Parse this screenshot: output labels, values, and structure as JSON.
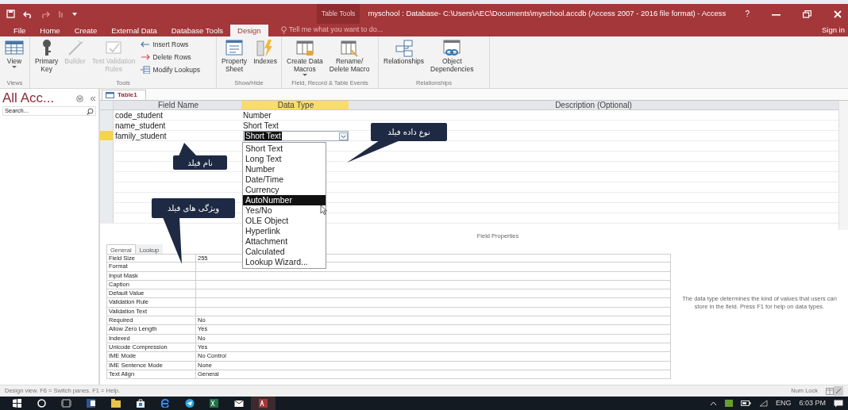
{
  "window": {
    "context_label": "Table Tools",
    "title": "myschool : Database- C:\\Users\\AEC\\Documents\\myschool.accdb (Access 2007 - 2016 file format) - Access",
    "help": "?"
  },
  "ribbon_tabs": [
    {
      "label": "File",
      "selected": false
    },
    {
      "label": "Home",
      "selected": false
    },
    {
      "label": "Create",
      "selected": false
    },
    {
      "label": "External Data",
      "selected": false
    },
    {
      "label": "Database Tools",
      "selected": false
    },
    {
      "label": "Design",
      "selected": true
    }
  ],
  "tell_me": {
    "placeholder": "Tell me what you want to do..."
  },
  "sign_in": "Sign in",
  "ribbon_groups": [
    {
      "label": "Views",
      "buttons": [
        {
          "label": "View",
          "kind": "large",
          "disabled": false,
          "dropdown": true
        }
      ]
    },
    {
      "label": "Tools",
      "buttons": [
        {
          "label": "Primary\nKey",
          "kind": "large",
          "disabled": false
        },
        {
          "label": "Builder",
          "kind": "large",
          "disabled": true
        },
        {
          "label": "Test Validation\nRules",
          "kind": "large",
          "disabled": true
        },
        {
          "label": "Insert Rows",
          "kind": "small",
          "disabled": false
        },
        {
          "label": "Delete Rows",
          "kind": "small",
          "disabled": false
        },
        {
          "label": "Modify Lookups",
          "kind": "small",
          "disabled": false
        }
      ]
    },
    {
      "label": "Show/Hide",
      "buttons": [
        {
          "label": "Property\nSheet",
          "kind": "large",
          "disabled": false
        },
        {
          "label": "Indexes",
          "kind": "large",
          "disabled": false
        }
      ]
    },
    {
      "label": "Field, Record & Table Events",
      "buttons": [
        {
          "label": "Create Data\nMacros",
          "kind": "large",
          "disabled": false,
          "dropdown": true
        },
        {
          "label": "Rename/\nDelete Macro",
          "kind": "large",
          "disabled": false
        }
      ]
    },
    {
      "label": "Relationships",
      "buttons": [
        {
          "label": "Relationships",
          "kind": "large",
          "disabled": false
        },
        {
          "label": "Object\nDependencies",
          "kind": "large",
          "disabled": false
        }
      ]
    }
  ],
  "nav_pane": {
    "title": "All Acc...",
    "search": {
      "placeholder": "Search..."
    }
  },
  "document_tabs": [
    {
      "label": "Table1",
      "selected": true
    }
  ],
  "design_grid": {
    "columns": [
      "Field Name",
      "Data Type",
      "Description (Optional)"
    ],
    "rows": [
      {
        "field_name": "code_student",
        "data_type": "Number",
        "selected": false
      },
      {
        "field_name": "name_student",
        "data_type": "Short Text",
        "selected": false
      },
      {
        "field_name": "family_student",
        "data_type": "Short Text",
        "selected": true
      }
    ]
  },
  "data_type_dropdown": {
    "options": [
      {
        "label": "Short Text",
        "selected": false
      },
      {
        "label": "Long Text",
        "selected": false
      },
      {
        "label": "Number",
        "selected": false
      },
      {
        "label": "Date/Time",
        "selected": false
      },
      {
        "label": "Currency",
        "selected": false
      },
      {
        "label": "AutoNumber",
        "selected": true
      },
      {
        "label": "Yes/No",
        "selected": false
      },
      {
        "label": "OLE Object",
        "selected": false
      },
      {
        "label": "Hyperlink",
        "selected": false
      },
      {
        "label": "Attachment",
        "selected": false
      },
      {
        "label": "Calculated",
        "selected": false
      },
      {
        "label": "Lookup Wizard...",
        "selected": false
      }
    ]
  },
  "field_properties": {
    "title": "Field Properties",
    "tabs": [
      {
        "label": "General",
        "selected": true
      },
      {
        "label": "Lookup",
        "selected": false
      }
    ],
    "rows": [
      {
        "name": "Field Size",
        "value": "255"
      },
      {
        "name": "Format"
      },
      {
        "name": "Input Mask"
      },
      {
        "name": "Caption"
      },
      {
        "name": "Default Value"
      },
      {
        "name": "Validation Rule"
      },
      {
        "name": "Validation Text"
      },
      {
        "name": "Required",
        "value": "No"
      },
      {
        "name": "Allow Zero Length",
        "value": "Yes"
      },
      {
        "name": "Indexed",
        "value": "No"
      },
      {
        "name": "Unicode Compression",
        "value": "Yes"
      },
      {
        "name": "IME Mode",
        "value": "No Control"
      },
      {
        "name": "IME Sentence Mode",
        "value": "None"
      },
      {
        "name": "Text Align",
        "value": "General"
      }
    ],
    "help": "The data type determines the kind of values that users can store in the field. Press F1 for help on data types."
  },
  "callouts": [
    {
      "text": "نام فیلد"
    },
    {
      "text": "نوع داده فیلد"
    },
    {
      "text": "ویژگی های فیلد"
    }
  ],
  "status_bar": {
    "text": "Design view.  F6 = Switch panes.  F1 = Help.",
    "num_lock": "Num Lock"
  },
  "taskbar": {
    "language": "ENG",
    "time": "6:03 PM"
  }
}
